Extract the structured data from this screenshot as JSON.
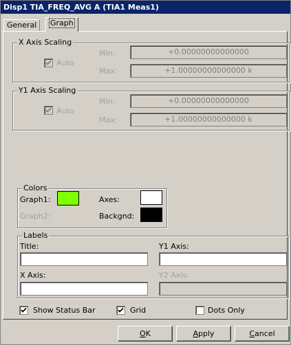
{
  "window": {
    "title": "Disp1 TIA_FREQ_AVG A (TIA1 Meas1)"
  },
  "tabs": [
    {
      "label": "General"
    },
    {
      "label": "Graph"
    }
  ],
  "x_axis": {
    "group_title": "X Axis Scaling",
    "auto_label": "Auto",
    "auto_checked": true,
    "min_label": "Min:",
    "min_value": "+0.00000000000000",
    "max_label": "Max:",
    "max_value": "+1.00000000000000 k"
  },
  "y1_axis": {
    "group_title": "Y1 Axis Scaling",
    "auto_label": "Auto",
    "auto_checked": true,
    "min_label": "Min:",
    "min_value": "+0.00000000000000",
    "max_label": "Max:",
    "max_value": "+1.00000000000000 k"
  },
  "colors": {
    "group_title": "Colors",
    "graph1_label": "Graph1:",
    "graph1_color": "#80ff00",
    "graph2_label": "Graph2:",
    "axes_label": "Axes:",
    "axes_color": "#ffffff",
    "backgnd_label": "Backgnd:",
    "backgnd_color": "#000000"
  },
  "labels": {
    "group_title": "Labels",
    "title_label": "Title:",
    "title_value": "",
    "y1_label": "Y1 Axis:",
    "y1_value": "",
    "x_label": "X Axis:",
    "x_value": "",
    "y2_label": "Y2 Axis:",
    "y2_value": ""
  },
  "options": {
    "status_bar_label": "Show Status Bar",
    "status_bar_checked": true,
    "grid_label": "Grid",
    "grid_checked": true,
    "dots_only_label": "Dots Only",
    "dots_only_checked": false
  },
  "buttons": {
    "ok_hotkey": "O",
    "ok_rest": "K",
    "apply_hotkey": "A",
    "apply_rest": "pply",
    "cancel_hotkey": "C",
    "cancel_rest": "ancel"
  }
}
